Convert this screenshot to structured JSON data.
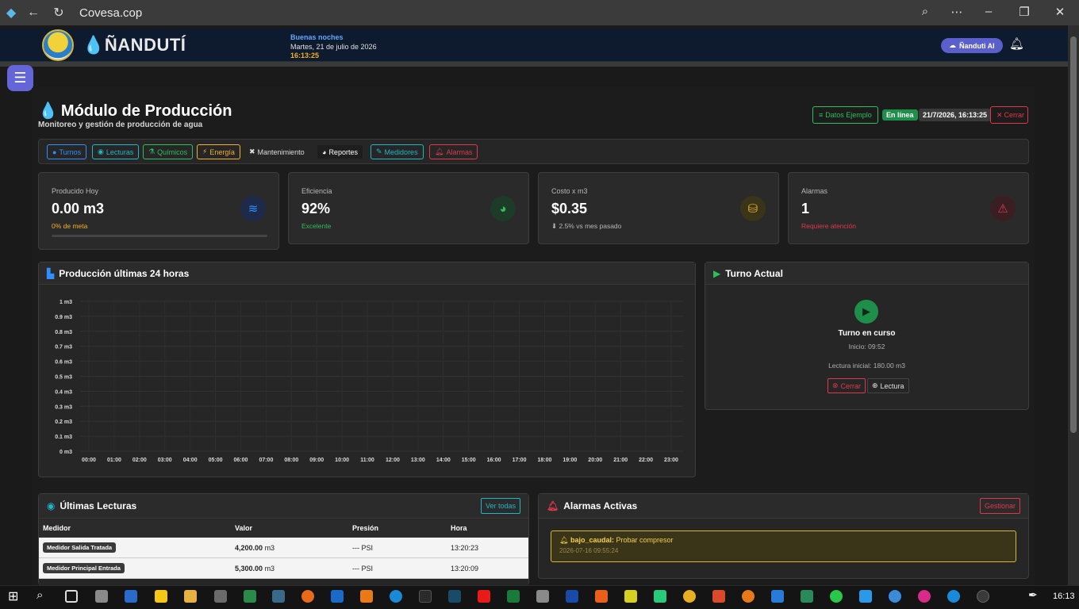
{
  "browser": {
    "url": "Covesa.cop"
  },
  "header": {
    "brand": "ÑANDUTÍ",
    "greeting": "Buenas noches",
    "date": "Martes, 21 de julio de 2026",
    "time": "16:13:25",
    "ai_button": "Ñanduti AI"
  },
  "page": {
    "title": "Módulo de Producción",
    "subtitle": "Monitoreo y gestión de producción de agua",
    "btn_sample": "Datos Ejemplo",
    "status": "En línea",
    "datetime": "21/7/2026, 16:13:25",
    "btn_close": "Cerrar"
  },
  "tabs": [
    {
      "label": "Turnos",
      "color": "#2f8fff"
    },
    {
      "label": "Lecturas",
      "color": "#1fb6c9"
    },
    {
      "label": "Químicos",
      "color": "#2fbf5a"
    },
    {
      "label": "Energía",
      "color": "#f5b027"
    },
    {
      "label": "Mantenimiento",
      "color": "#dcdcdc"
    },
    {
      "label": "Reportes",
      "color": "#ffffff"
    },
    {
      "label": "Medidores",
      "color": "#1fb6c9"
    },
    {
      "label": "Alarmas",
      "color": "#e0384b"
    }
  ],
  "stats": [
    {
      "label": "Producido Hoy",
      "value": "0.00 m3",
      "note": "0% de meta",
      "note_color": "#f5b027",
      "progress": 0
    },
    {
      "label": "Eficiencia",
      "value": "92%",
      "note": "Excelente",
      "note_color": "#2fbf5a"
    },
    {
      "label": "Costo x m3",
      "value": "$0.35",
      "note": "⬇ 2.5% vs mes pasado",
      "note_color": "#b8b8b8"
    },
    {
      "label": "Alarmas",
      "value": "1",
      "note": "Requiere atención",
      "note_color": "#e0384b"
    }
  ],
  "chart": {
    "title": "Producción últimas 24 horas"
  },
  "chart_data": {
    "type": "line",
    "title": "Producción últimas 24 horas",
    "x": [
      "00:00",
      "01:00",
      "02:00",
      "03:00",
      "04:00",
      "05:00",
      "06:00",
      "07:00",
      "08:00",
      "09:00",
      "10:00",
      "11:00",
      "12:00",
      "13:00",
      "14:00",
      "15:00",
      "16:00",
      "17:00",
      "18:00",
      "19:00",
      "20:00",
      "21:00",
      "22:00",
      "23:00"
    ],
    "y_ticks": [
      "1 m3",
      "0.9 m3",
      "0.8 m3",
      "0.7 m3",
      "0.6 m3",
      "0.5 m3",
      "0.4 m3",
      "0.3 m3",
      "0.2 m3",
      "0.1 m3",
      "0 m3"
    ],
    "ylim": [
      0,
      1
    ],
    "series": [],
    "grid": true
  },
  "turno": {
    "title": "Turno Actual",
    "status": "Turno en curso",
    "start": "Inicio: 09:52",
    "initial": "Lectura inicial: 180.00 m3",
    "btn_close": "Cerrar",
    "btn_read": "Lectura"
  },
  "lecturas": {
    "title": "Últimas Lecturas",
    "btn_all": "Ver todas",
    "columns": [
      "Medidor",
      "Valor",
      "Presión",
      "Hora"
    ],
    "rows": [
      {
        "medidor": "Medidor Salida Tratada",
        "valor": "4,200.00",
        "unit": "m3",
        "presion": "--- PSI",
        "hora": "13:20:23"
      },
      {
        "medidor": "Medidor Principal Entrada",
        "valor": "5,300.00",
        "unit": "m3",
        "presion": "--- PSI",
        "hora": "13:20:09"
      }
    ]
  },
  "alarmas": {
    "title": "Alarmas Activas",
    "btn_manage": "Gestionar",
    "item_type": "bajo_caudal:",
    "item_text": "Probar compresor",
    "item_time": "2026-07-16 09:55:24"
  },
  "taskbar": {
    "clock": "16:13"
  }
}
